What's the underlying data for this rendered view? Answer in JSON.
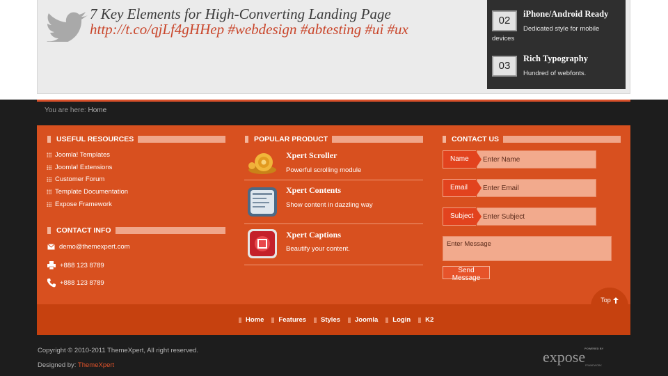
{
  "tweet": {
    "title": "7 Key Elements for High-Converting Landing Page",
    "link": "http://t.co/qjLf4gHHep #webdesign #abtesting #ui #ux"
  },
  "features": [
    {
      "number": "02",
      "title": "iPhone/Android Ready",
      "desc_line1": "Dedicated style for mobile",
      "desc_line2": "devices"
    },
    {
      "number": "03",
      "title": "Rich Typography",
      "desc_line1": "Hundred of webfonts.",
      "desc_line2": ""
    }
  ],
  "breadcrumb": {
    "prefix": "You are here:",
    "current": "Home"
  },
  "useful_resources": {
    "heading": "USEFUL RESOURCES",
    "items": [
      "Joomla! Templates",
      "Joomla! Extensions",
      "Customer Forum",
      "Template Documentation",
      "Expose Framework"
    ]
  },
  "contact_info": {
    "heading": "CONTACT INFO",
    "email": "demo@themexpert.com",
    "fax": "+888 123 8789",
    "phone": "+888 123 8789"
  },
  "popular_product": {
    "heading": "POPULAR PRODUCT",
    "items": [
      {
        "name": "Xpert Scroller",
        "desc": "Powerful scrolling module",
        "icon": "snail-icon"
      },
      {
        "name": "Xpert Contents",
        "desc": "Show content in dazzling way",
        "icon": "contents-icon"
      },
      {
        "name": "Xpert Captions",
        "desc": "Beautify your content.",
        "icon": "captions-icon"
      }
    ]
  },
  "contact_us": {
    "heading": "CONTACT US",
    "name_label": "Name",
    "name_placeholder": "Enter Name",
    "email_label": "Email",
    "email_placeholder": "Enter Email",
    "subject_label": "Subject",
    "subject_placeholder": "Enter Subject",
    "message_placeholder": "Enter Message",
    "send_label": "Send Message"
  },
  "top_button": {
    "label": "Top"
  },
  "nav": [
    "Home",
    "Features",
    "Styles",
    "Joomla",
    "Login",
    "K2"
  ],
  "footer": {
    "copyright": "Copyright © 2010-2011 ThemeXpert, All right reserved.",
    "designed_prefix": "Designed by:",
    "designed_brand": "ThemeXpert",
    "logo_text": "expose",
    "logo_top": "POWERED BY",
    "logo_bottom": "FRAMEWORK"
  },
  "colors": {
    "accent": "#d8501f",
    "accent_dark": "#c6410f",
    "background": "#1d1d1d"
  }
}
